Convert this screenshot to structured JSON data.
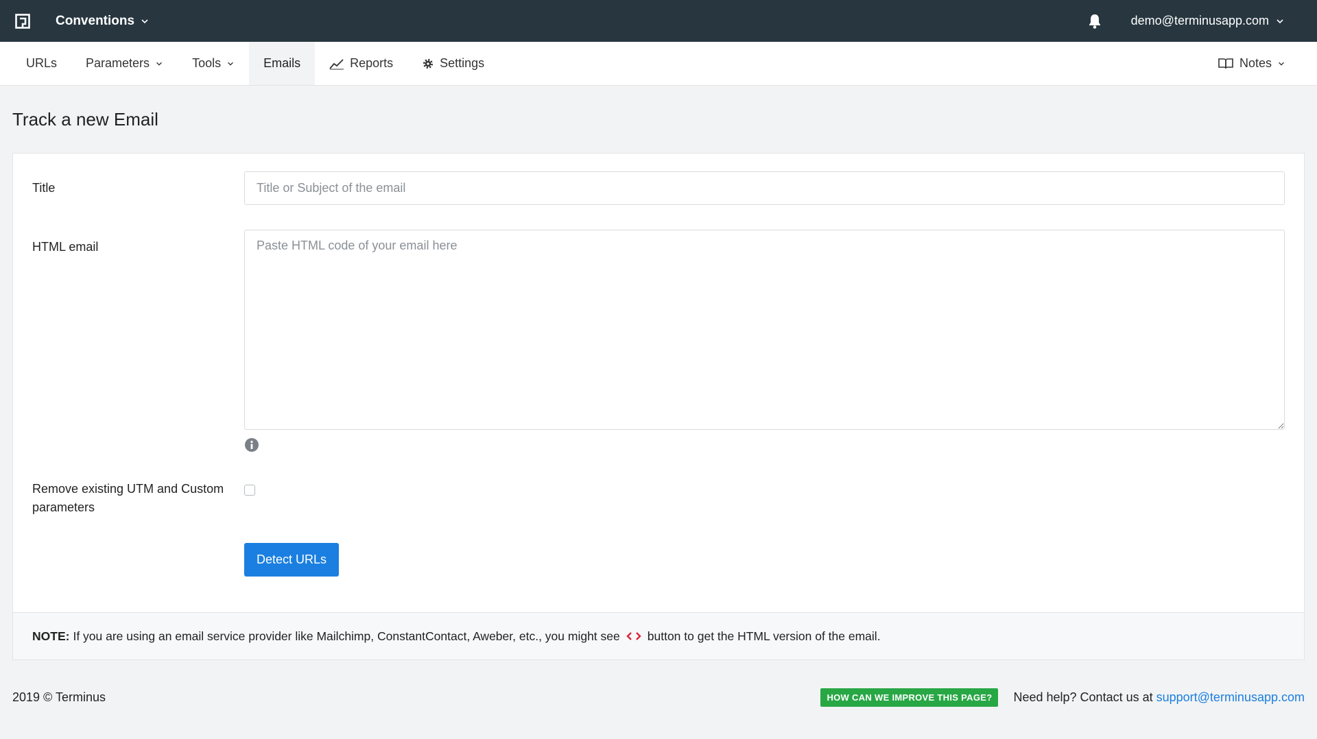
{
  "topbar": {
    "workspace": "Conventions",
    "account": "demo@terminusapp.com"
  },
  "nav": {
    "items": [
      {
        "label": "URLs"
      },
      {
        "label": "Parameters"
      },
      {
        "label": "Tools"
      },
      {
        "label": "Emails"
      },
      {
        "label": "Reports"
      },
      {
        "label": "Settings"
      }
    ],
    "active": "Emails",
    "notes": "Notes"
  },
  "page": {
    "title": "Track a new Email"
  },
  "form": {
    "title_label": "Title",
    "title_placeholder": "Title or Subject of the email",
    "html_label": "HTML email",
    "html_placeholder": "Paste HTML code of your email here",
    "remove_params_label": "Remove existing UTM and Custom parameters",
    "remove_params_checked": false,
    "detect_button": "Detect URLs"
  },
  "note": {
    "prefix": "NOTE:",
    "text_before": "If you are using an email service provider like Mailchimp, ConstantContact, Aweber, etc., you might see",
    "text_after": "button to get the HTML version of the email."
  },
  "footer": {
    "copyright": "2019 © Terminus",
    "improve_button": "HOW CAN WE IMPROVE THIS PAGE?",
    "help_text": "Need help? Contact us at",
    "help_email": "support@terminusapp.com"
  },
  "colors": {
    "topbar": "#27363f",
    "primary": "#1a7fe0",
    "success": "#28a745",
    "code_icon": "#d9263a"
  }
}
